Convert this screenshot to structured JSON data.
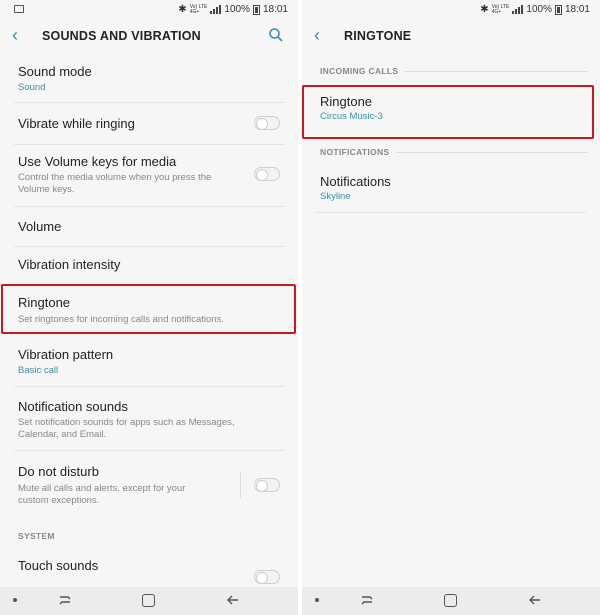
{
  "status": {
    "battery": "100%",
    "time": "18:01",
    "network_top": "Vo) LTE",
    "network_bottom": "4G+"
  },
  "left": {
    "title": "SOUNDS AND VIBRATION",
    "items": [
      {
        "title": "Sound mode",
        "subtitle": "Sound"
      },
      {
        "title": "Vibrate while ringing",
        "toggle": false
      },
      {
        "title": "Use Volume keys for media",
        "subtitle": "Control the media volume when you press the Volume keys.",
        "toggle": false
      },
      {
        "title": "Volume"
      },
      {
        "title": "Vibration intensity"
      },
      {
        "title": "Ringtone",
        "subtitle": "Set ringtones for incoming calls and notifications."
      },
      {
        "title": "Vibration pattern",
        "subtitle": "Basic call"
      },
      {
        "title": "Notification sounds",
        "subtitle": "Set notification sounds for apps such as Messages, Calendar, and Email."
      },
      {
        "title": "Do not disturb",
        "subtitle": "Mute all calls and alerts, except for your custom exceptions.",
        "toggle": false
      }
    ],
    "section_system": "SYSTEM",
    "last_item": {
      "title": "Touch sounds"
    }
  },
  "right": {
    "title": "RINGTONE",
    "section_incoming": "INCOMING CALLS",
    "ringtone": {
      "title": "Ringtone",
      "subtitle": "Circus Music-3"
    },
    "section_notifications": "NOTIFICATIONS",
    "notifications": {
      "title": "Notifications",
      "subtitle": "Skyline"
    }
  },
  "colors": {
    "accent": "#3a8fa6",
    "highlight": "#c9181f",
    "background": "#f6f6f6"
  }
}
